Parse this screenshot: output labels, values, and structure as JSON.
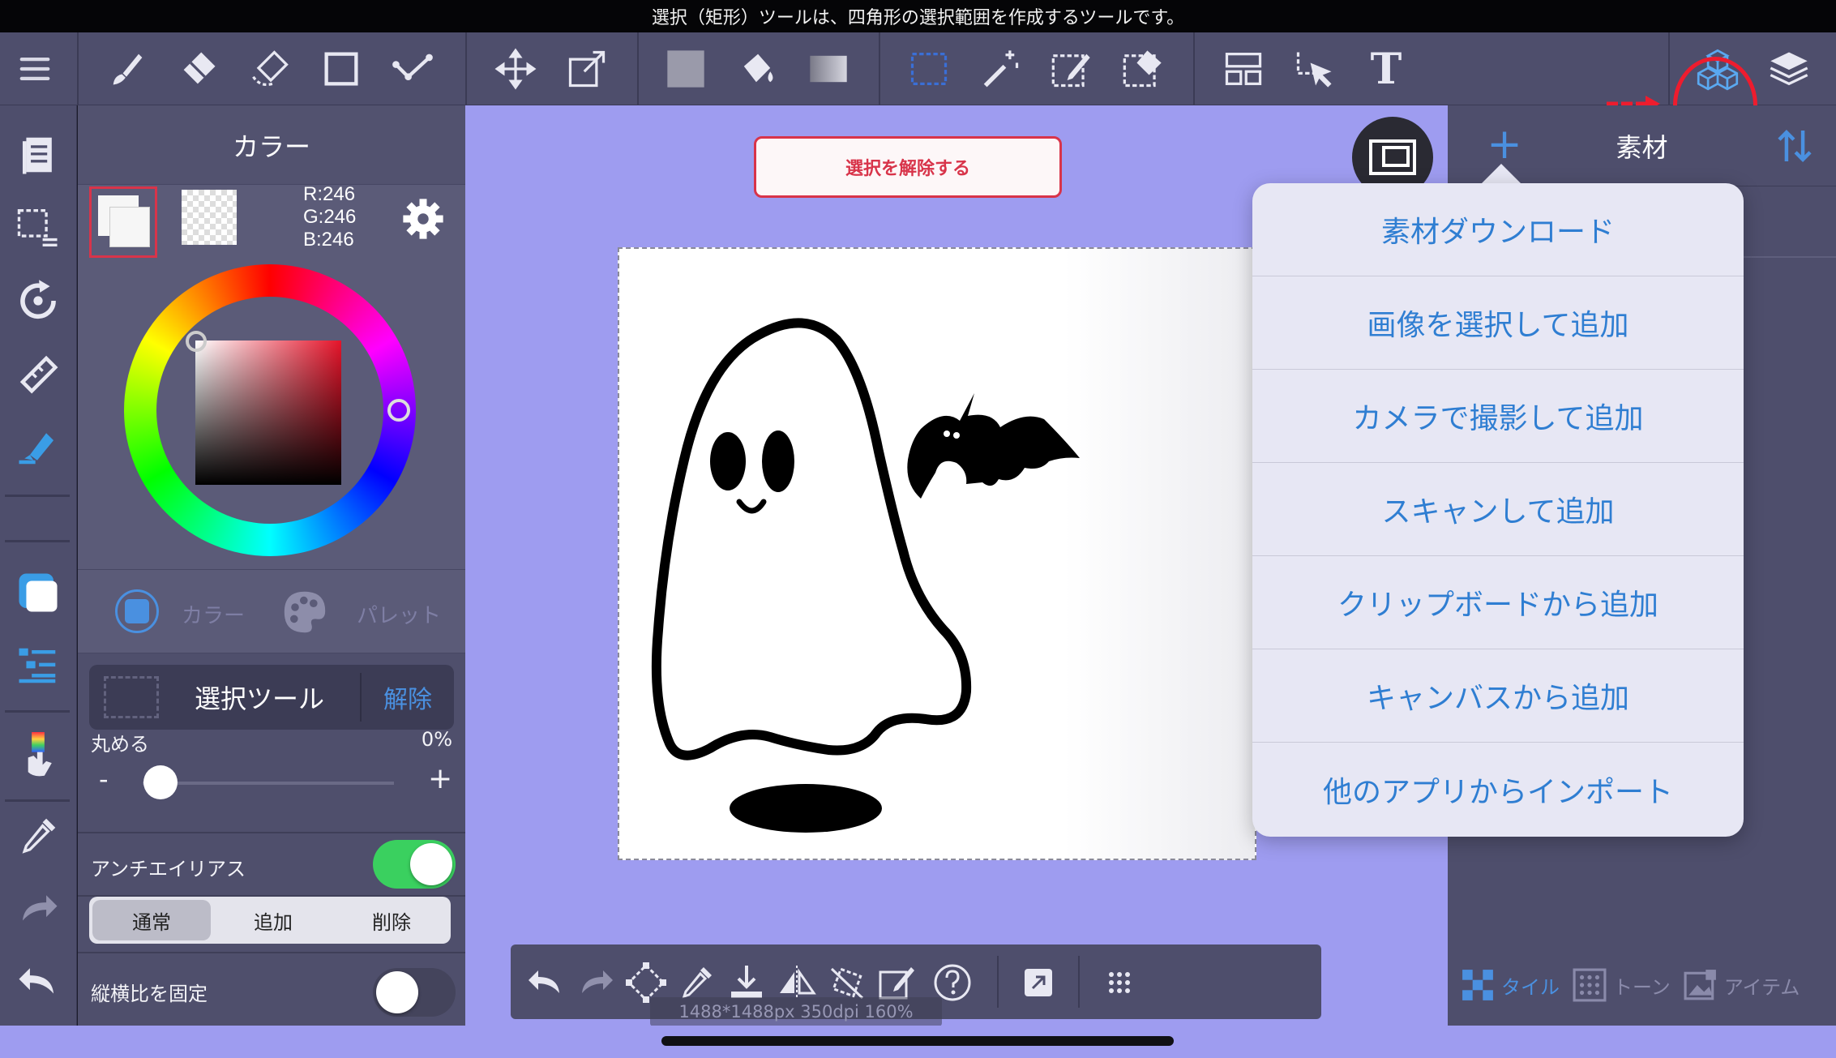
{
  "status_bar": {
    "tooltip": "選択（矩形）ツールは、四角形の選択範囲を作成するツールです。"
  },
  "toolbar": {
    "icons": [
      "menu-icon",
      "brush-icon",
      "eraser-icon",
      "blur-icon",
      "rectangle-icon",
      "curve-icon",
      "move-icon",
      "transform-icon",
      "fill-color-icon",
      "bucket-icon",
      "gradient-icon",
      "select-rect-icon",
      "magic-wand-icon",
      "select-pen-icon",
      "select-eraser-icon",
      "frame-divider-icon",
      "select-layer-icon",
      "text-icon",
      "material-icon",
      "layers-icon"
    ],
    "text_tool_glyph": "T"
  },
  "color_panel": {
    "title": "カラー",
    "rgb": {
      "r": "R:246",
      "g": "G:246",
      "b": "B:246"
    },
    "tabs": {
      "color": "カラー",
      "palette": "パレット"
    }
  },
  "tool_props": {
    "tool_name": "選択ツール",
    "release_label": "解除",
    "round_label": "丸める",
    "round_value": "0%",
    "round_level": 0,
    "minus": "-",
    "plus": "+",
    "antialias_label": "アンチエイリアス",
    "antialias_on": true,
    "modes": [
      "通常",
      "追加",
      "削除"
    ],
    "selected_mode": 0,
    "aspect_label": "縦横比を固定",
    "aspect_on": false
  },
  "canvas": {
    "deselect_label": "選択を解除する",
    "info": "1488*1488px 350dpi 160%"
  },
  "material_panel": {
    "title": "素材",
    "add_icon": "+",
    "tabs": [
      "タイル",
      "トーン",
      "アイテム"
    ]
  },
  "material_menu": {
    "items": [
      "素材ダウンロード",
      "画像を選択して追加",
      "カメラで撮影して追加",
      "スキャンして追加",
      "クリップボードから追加",
      "キャンバスから追加",
      "他のアプリからインポート"
    ]
  },
  "colors": {
    "accent_red": "#d8344a",
    "menu_text": "#2f7ed2",
    "toggle_on": "#3ad05f",
    "workspace": "#9e9cf0"
  }
}
